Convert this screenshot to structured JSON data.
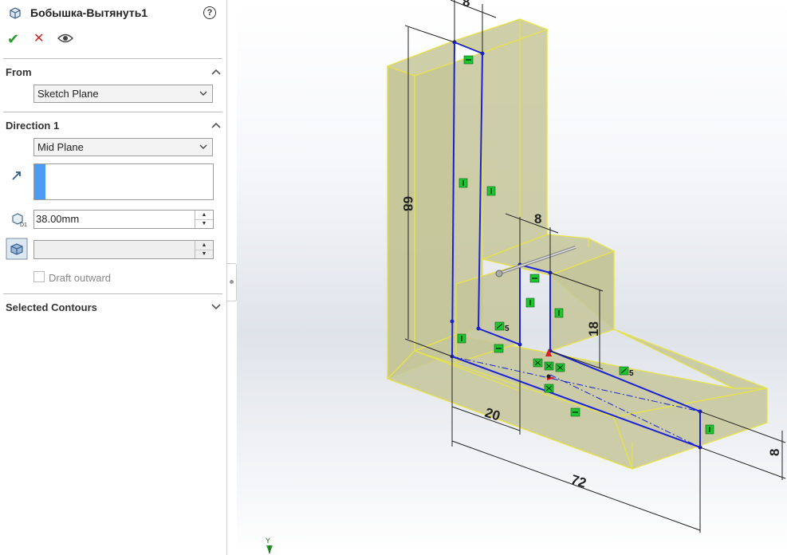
{
  "feature": {
    "title": "Бобышка-Вытянуть1",
    "help": "?",
    "ok": "✔",
    "cancel": "✕"
  },
  "from": {
    "heading": "From",
    "select_value": "Sketch Plane"
  },
  "direction1": {
    "heading": "Direction 1",
    "end_condition": "Mid Plane",
    "depth": "38.00mm",
    "draft_value": "",
    "draft_outward_label": "Draft outward",
    "draft_outward_checked": false
  },
  "selected_contours": {
    "heading": "Selected Contours"
  },
  "viewport": {
    "dimensions": {
      "top_width": "8",
      "height_68": "68",
      "mid_width": "8",
      "height_18": "18",
      "base_20": "20",
      "length_72": "72",
      "thickness_8": "8"
    },
    "relation_5a": "5",
    "relation_5b": "5",
    "triad_label": "Y",
    "colors": {
      "body_fill": "#c9c89a",
      "body_edge": "#e6e34a",
      "sketch": "#1a22d4",
      "relation": "#1fc431"
    }
  }
}
